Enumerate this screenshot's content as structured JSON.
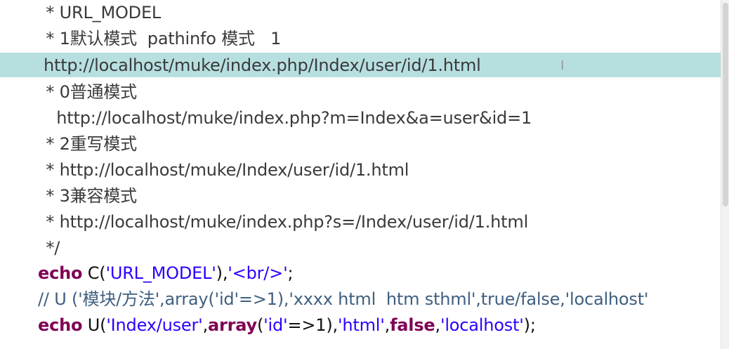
{
  "editor": {
    "lines": [
      " * URL_MODEL",
      " * 1默认模式  pathinfo 模式   1",
      "http://localhost/muke/index.php/Index/user/id/1.html",
      " * 0普通模式",
      "   http://localhost/muke/index.php?m=Index&a=user&id=1",
      " * 2重写模式",
      " * http://localhost/muke/Index/user/id/1.html",
      " * 3兼容模式",
      " * http://localhost/muke/index.php?s=/Index/user/id/1.html",
      " */"
    ],
    "echo1": {
      "kw": "echo",
      "rest": " C(",
      "str1": "'URL_MODEL'",
      "mid": "),",
      "str2": "'<br/>'",
      "end": ";"
    },
    "comment_line": "// U ('模块/方法',array('id'=>1),'xxxx html  htm sthml',true/false,'localhost'",
    "echo2": {
      "kw": "echo",
      "fn": " U(",
      "str1": "'Index/user'",
      "comma1": ",",
      "kw_array": "array",
      "paren_open": "(",
      "str2": "'id'",
      "arrow": "=>1),",
      "str3": "'html'",
      "comma2": ",",
      "kw_false": "false",
      "comma3": ",",
      "str4": "'localhost'",
      "end": ");"
    },
    "cursor_glyph": "I"
  },
  "colors": {
    "highlight": "#b7dfe0",
    "keyword": "#7f0055",
    "string": "#2a00ff",
    "comment": "#3a3a3a"
  }
}
